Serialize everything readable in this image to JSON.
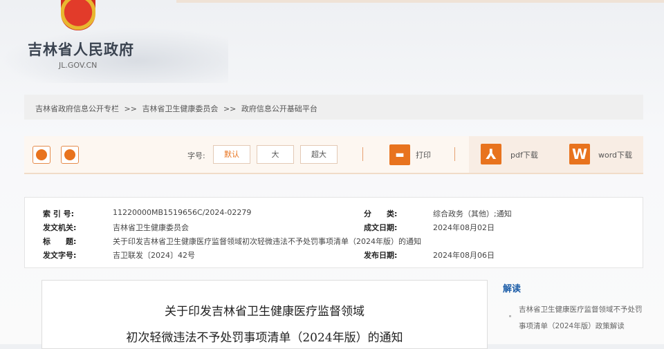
{
  "header": {
    "title": "吉林省人民政府",
    "domain": "JL.GOV.CN"
  },
  "breadcrumb": [
    "吉林省政府信息公开专栏",
    ">>",
    "吉林省卫生健康委员会",
    ">>",
    "政府信息公开基础平台"
  ],
  "toolbar": {
    "font_label": "字号:",
    "font_default": "默认",
    "font_large": "大",
    "font_xlarge": "超大",
    "print": "打印",
    "pdf": "pdf下载",
    "word": "word下载",
    "accent": "#e8731e"
  },
  "info": {
    "index_label": "索 引 号:",
    "index": "11220000MB1519656C/2024-02279",
    "category_label": "分　　类:",
    "category": "综合政务（其他）;通知",
    "issuer_label": "发文机关:",
    "issuer": "吉林省卫生健康委员会",
    "written_label": "成文日期:",
    "written": "2024年08月02日",
    "title_label": "标　　题:",
    "title": "关于印发吉林省卫生健康医疗监督领域初次轻微违法不予处罚事项清单（2024年版）的通知",
    "docno_label": "发文字号:",
    "docno": "吉卫联发〔2024〕42号",
    "published_label": "发布日期:",
    "published": "2024年08月06日"
  },
  "document": {
    "title_line1": "关于印发吉林省卫生健康医疗监督领域",
    "title_line2": "初次轻微违法不予处罚事项清单（2024年版）的通知"
  },
  "sidebar": {
    "heading": "解读",
    "item_line1": "吉林省卫生健康医疗监督领域不予处罚",
    "item_line2": "事项清单（2024年版）政策解读"
  }
}
